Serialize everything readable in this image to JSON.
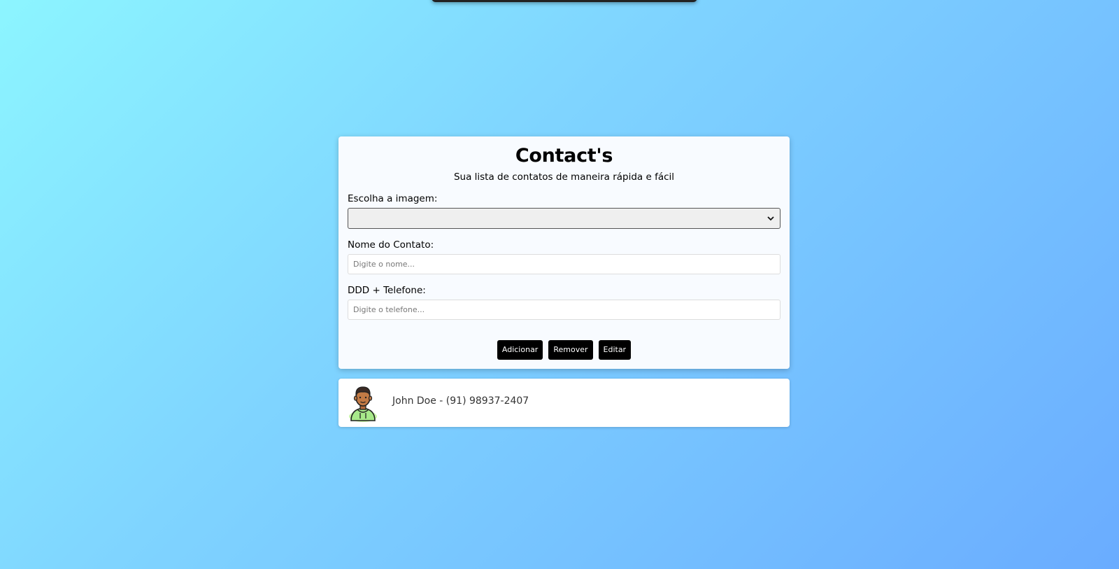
{
  "header": {
    "title": "Contact's",
    "subtitle": "Sua lista de contatos de maneira rápida e fácil"
  },
  "form": {
    "image_label": "Escolha a imagem:",
    "image_selected": "",
    "name_label": "Nome do Contato:",
    "name_placeholder": "Digite o nome...",
    "name_value": "",
    "phone_label": "DDD + Telefone:",
    "phone_placeholder": "Digite o telefone...",
    "phone_value": ""
  },
  "actions": {
    "add_label": "Adicionar",
    "remove_label": "Remover",
    "edit_label": "Editar"
  },
  "contacts": [
    {
      "text": "John Doe - (91) 98937-2407",
      "avatar_icon": "male-avatar-icon"
    }
  ],
  "colors": {
    "background_start": "#8cf5ff",
    "background_end": "#6aacff",
    "button_bg": "#000000",
    "button_text": "#ffffff"
  }
}
